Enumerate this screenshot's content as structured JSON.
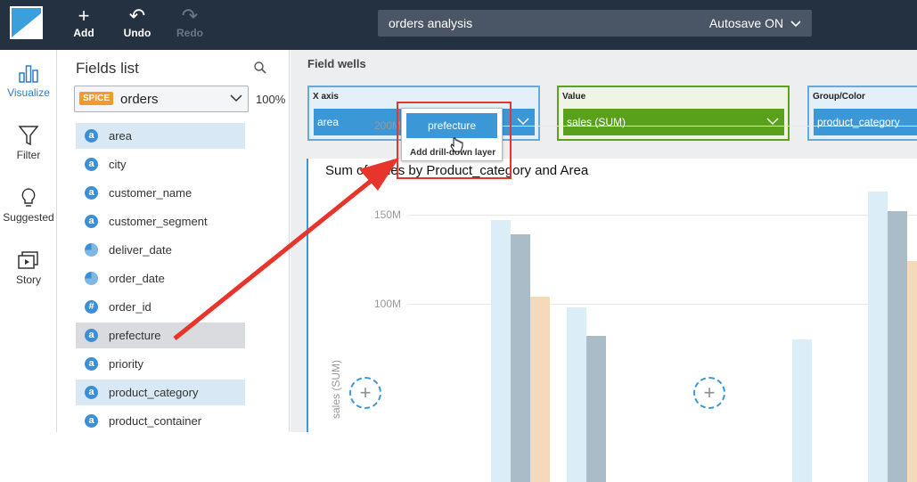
{
  "toolbar": {
    "add_label": "Add",
    "undo_label": "Undo",
    "redo_label": "Redo",
    "analysis_name": "orders analysis",
    "autosave_label": "Autosave ON"
  },
  "nav": {
    "items": [
      {
        "label": "Visualize",
        "icon": "bar-chart-icon"
      },
      {
        "label": "Filter",
        "icon": "filter-icon"
      },
      {
        "label": "Suggested",
        "icon": "lightbulb-icon"
      },
      {
        "label": "Story",
        "icon": "story-icon"
      }
    ]
  },
  "fields_list": {
    "title": "Fields list",
    "spice_badge": "SPICE",
    "dataset": "orders",
    "percent": "100%",
    "fields": [
      {
        "name": "area",
        "type": "a"
      },
      {
        "name": "city",
        "type": "a"
      },
      {
        "name": "customer_name",
        "type": "a"
      },
      {
        "name": "customer_segment",
        "type": "a"
      },
      {
        "name": "deliver_date",
        "type": "date"
      },
      {
        "name": "order_date",
        "type": "date"
      },
      {
        "name": "order_id",
        "type": "#"
      },
      {
        "name": "prefecture",
        "type": "a"
      },
      {
        "name": "priority",
        "type": "a"
      },
      {
        "name": "product_category",
        "type": "a"
      },
      {
        "name": "product_container",
        "type": "a"
      }
    ]
  },
  "field_wells": {
    "title": "Field wells",
    "x_axis": {
      "label": "X axis",
      "value": "area"
    },
    "value": {
      "label": "Value",
      "value": "sales (SUM)"
    },
    "group": {
      "label": "Group/Color",
      "value": "product_category"
    }
  },
  "drilldown": {
    "pill": "prefecture",
    "hint": "Add drill-down layer"
  },
  "chart_data": {
    "type": "bar",
    "title": "Sum of Sales by Product_category and Area",
    "ylabel": "sales (SUM)",
    "y_ticks": [
      "200M",
      "150M",
      "100M"
    ],
    "ylim": [
      0,
      200
    ],
    "series": [
      {
        "name": "",
        "color": "#dbeef7",
        "values": [
          147,
          98,
          0,
          163
        ]
      },
      {
        "name": "",
        "color": "#a9bcc8",
        "values": [
          139,
          82,
          0,
          152
        ]
      },
      {
        "name": "",
        "color": "#f6d9b9",
        "values": [
          104,
          0,
          0,
          124
        ]
      }
    ],
    "small_bar": {
      "color": "#dbeef7",
      "value": 80
    }
  },
  "colors": {
    "topbar": "#243141",
    "accent": "#3b97d6",
    "value_well": "#5aa11b",
    "annotation_red": "#e8352b"
  }
}
